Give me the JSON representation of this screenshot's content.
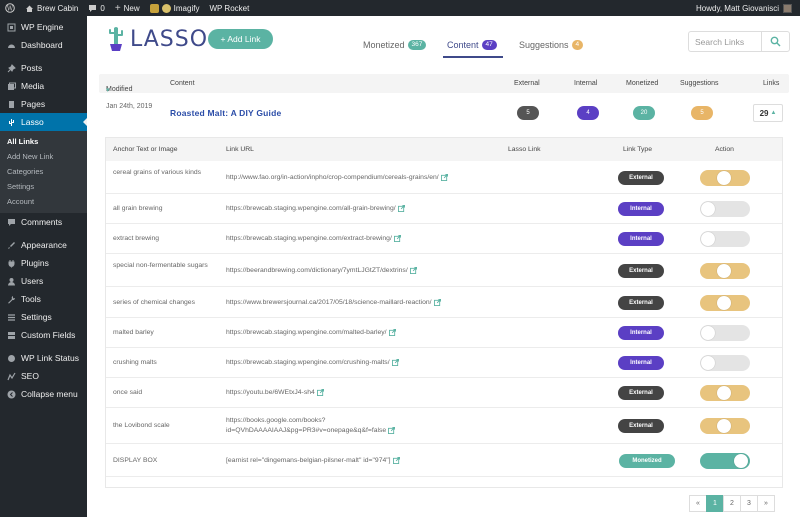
{
  "adminbar": {
    "site": "Brew Cabin",
    "comments": "0",
    "new": "New",
    "imagify": "Imagify",
    "wprocket": "WP Rocket",
    "howdy": "Howdy, Matt Giovanisci"
  },
  "sidebar": {
    "items": [
      {
        "label": "WP Engine",
        "icon": "wp-engine-icon"
      },
      {
        "label": "Dashboard",
        "icon": "dashboard-icon"
      },
      {
        "label": "Posts",
        "icon": "pin-icon"
      },
      {
        "label": "Media",
        "icon": "media-icon"
      },
      {
        "label": "Pages",
        "icon": "pages-icon"
      },
      {
        "label": "Lasso",
        "icon": "cactus-icon"
      },
      {
        "label": "Comments",
        "icon": "comment-icon"
      },
      {
        "label": "Appearance",
        "icon": "brush-icon"
      },
      {
        "label": "Plugins",
        "icon": "plug-icon"
      },
      {
        "label": "Users",
        "icon": "user-icon"
      },
      {
        "label": "Tools",
        "icon": "wrench-icon"
      },
      {
        "label": "Settings",
        "icon": "settings-icon"
      },
      {
        "label": "Custom Fields",
        "icon": "fields-icon"
      },
      {
        "label": "WP Link Status",
        "icon": "link-status-icon"
      },
      {
        "label": "SEO",
        "icon": "seo-icon"
      },
      {
        "label": "Collapse menu",
        "icon": "collapse-icon"
      }
    ],
    "submenu": [
      "All Links",
      "Add New Link",
      "Categories",
      "Settings",
      "Account"
    ]
  },
  "header": {
    "logo_text": "LASSO",
    "add_link": "+ Add Link",
    "tabs": [
      {
        "label": "Monetized",
        "count": "367"
      },
      {
        "label": "Content",
        "count": "47"
      },
      {
        "label": "Suggestions",
        "count": "4"
      }
    ],
    "search_placeholder": "Search Links"
  },
  "summary": {
    "headers": {
      "modified": "Modified",
      "content": "Content",
      "external": "External",
      "internal": "Internal",
      "monetized": "Monetized",
      "suggestions": "Suggestions",
      "links": "Links"
    },
    "row": {
      "date": "Jan 24th, 2019",
      "title": "Roasted Malt: A DIY Guide",
      "external": "5",
      "internal": "4",
      "monetized": "20",
      "suggestions": "5",
      "links": "29"
    }
  },
  "detail": {
    "headers": {
      "anchor": "Anchor Text or Image",
      "url": "Link URL",
      "lasso": "Lasso Link",
      "type": "Link Type",
      "action": "Action"
    },
    "rows": [
      {
        "anchor": "cereal grains of various kinds",
        "url": "http://www.fao.org/in-action/inpho/crop-compendium/cereals-grains/en/",
        "type": "External",
        "toggle": "on"
      },
      {
        "anchor": "all grain brewing",
        "url": "https://brewcab.staging.wpengine.com/all-grain-brewing/",
        "type": "Internal",
        "toggle": "off"
      },
      {
        "anchor": "extract brewing",
        "url": "https://brewcab.staging.wpengine.com/extract-brewing/",
        "type": "Internal",
        "toggle": "off"
      },
      {
        "anchor": "special non-fermentable sugars",
        "url": "https://beerandbrewing.com/dictionary/7ymtLJGtZT/dextrins/",
        "type": "External",
        "toggle": "on"
      },
      {
        "anchor": "series of chemical changes",
        "url": "https://www.brewersjournal.ca/2017/05/18/science-maillard-reaction/",
        "type": "External",
        "toggle": "on"
      },
      {
        "anchor": "malted barley",
        "url": "https://brewcab.staging.wpengine.com/malted-barley/",
        "type": "Internal",
        "toggle": "off"
      },
      {
        "anchor": "crushing malts",
        "url": "https://brewcab.staging.wpengine.com/crushing-malts/",
        "type": "Internal",
        "toggle": "off"
      },
      {
        "anchor": "once said",
        "url": "https://youtu.be/6WEtxJ4-sh4",
        "type": "External",
        "toggle": "on"
      },
      {
        "anchor": "the Lovibond scale",
        "url": "https://books.google.com/books?id=QVhDAAAAIAAJ&pg=PR3#v=onepage&q&f=false",
        "type": "External",
        "toggle": "on"
      },
      {
        "anchor": "DISPLAY BOX",
        "url": "[earnist rel=\"dingemans-belgian-pilsner-malt\" id=\"974\"]",
        "type": "Monetized",
        "toggle": "on-green"
      }
    ]
  },
  "pagination": {
    "prev": "«",
    "pages": [
      "1",
      "2",
      "3"
    ],
    "next": "»"
  }
}
